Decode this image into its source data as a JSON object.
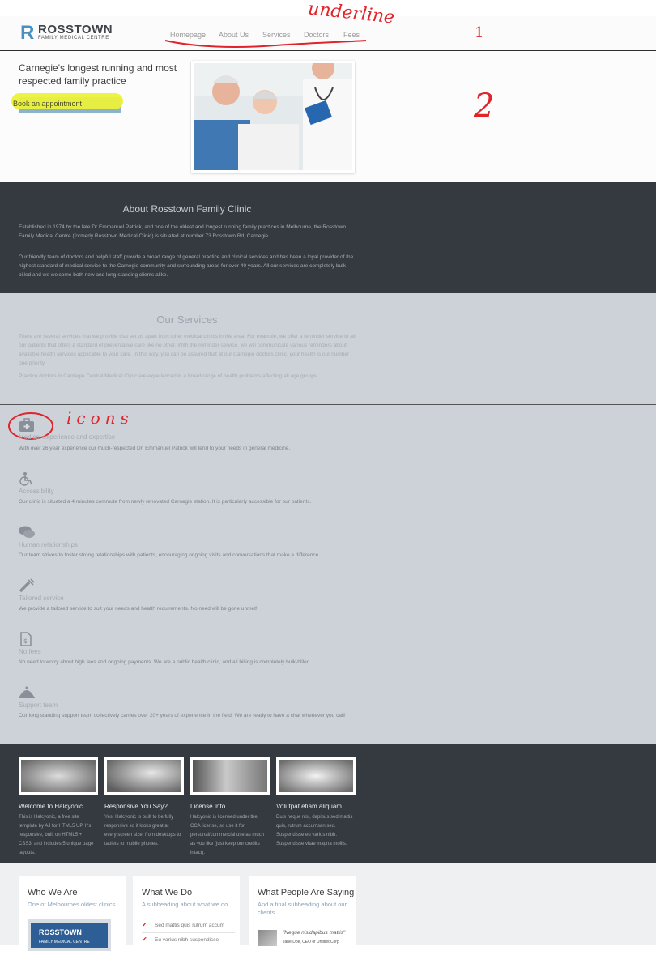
{
  "header": {
    "logo_mark": "R",
    "logo_name": "ROSSTOWN",
    "logo_sub": "FAMILY MEDICAL CENTRE",
    "nav": [
      "Homepage",
      "About Us",
      "Services",
      "Doctors",
      "Fees"
    ]
  },
  "annotations": {
    "underline": "underline",
    "one": "1",
    "two": "2",
    "icons": "icons"
  },
  "hero": {
    "title": "Carnegie's longest running and most respected family practice",
    "button": "Book an appointment"
  },
  "about": {
    "title": "About Rosstown Family Clinic",
    "p1": "Established in 1974 by the late Dr Emmanuel Patrick, and one of the oldest and longest running family practices in Melbourne, the Rosstown Family Medical Centre (formerly Rosstown Medical Clinic) is situated at number 73 Rosstown Rd, Carnegie.",
    "p2": "Our friendly team of doctors and helpful staff provide a broad range of general practice and clinical services and has been a loyal provider of the highest standard of medical service to the Carnegie community and surrounding areas for over 40 years. All our services are completely bulk-billed and we welcome both new and long-standing clients alike."
  },
  "services": {
    "title": "Our Services",
    "p1": "There are several services that we provide that set us apart from other medical clinics in the area. For example, we offer a reminder service to all our patients that offers a standard of preventative care like no other. With the reminder service, we will communicate various reminders about available health services applicable to your care. In this way, you can be assured that at our Carnegie doctors clinic, your health is our number one priority.",
    "p2": "Practice doctors in Carnegie Central Medical Clinic are experienced in a broad range of health problems affecting all age groups.",
    "items": [
      {
        "icon": "medical-kit-icon",
        "title": "Medical experience and expertise",
        "desc": "With over 26 year experience our much-respected Dr. Emmanuel Patrick will tend to your needs in general medicine."
      },
      {
        "icon": "wheelchair-icon",
        "title": "Accessibility",
        "desc": "Our clinic is situated a 4 minutes commute from newly renovated Carnegie station. It is particularly accessible for our patients."
      },
      {
        "icon": "chat-bubbles-icon",
        "title": "Human relationships",
        "desc": "Our team strives to foster strong relationships with patients, encouraging ongoing visits and conversations that make a difference."
      },
      {
        "icon": "syringe-icon",
        "title": "Tailored service",
        "desc": "We provide a tailored service to suit your needs and health requirements. No need will be gone unmet!"
      },
      {
        "icon": "document-icon",
        "title": "No fees",
        "desc": "No need to worry about high fees and ongoing payments. We are a public health clinic, and all billing is completely bulk-billed."
      },
      {
        "icon": "service-bell-icon",
        "title": "Support team",
        "desc": "Our long standing support team collectively carries over 20+ years of experience in the field. We are ready to have a chat whenever you call!"
      }
    ]
  },
  "features": [
    {
      "title": "Welcome to Halcyonic",
      "text": "This is Halcyonic, a free site template by AJ for HTML5 UP. It's responsive, built on HTML5 + CSS3, and includes 5 unique page layouts."
    },
    {
      "title": "Responsive You Say?",
      "text": "Yes! Halcyonic is built to be fully responsive so it looks great at every screen size, from desktops to tablets to mobile phones."
    },
    {
      "title": "License Info",
      "text": "Halcyonic is licensed under the CCA license, so use it for personal/commercial use as much as you like (just keep our credits intact)."
    },
    {
      "title": "Volutpat etiam aliquam",
      "text": "Duis neque nisi, dapibus sed mattis quis, rutrum accumsan sed. Suspendisse eu varius nibh. Suspendisse vitae magna mollis."
    }
  ],
  "cards": [
    {
      "title": "Who We Are",
      "sub": "One of Melbournes oldest clinics"
    },
    {
      "title": "What We Do",
      "sub": "A subheading about what we do",
      "list": [
        "Sed mattis quis rutrum accum",
        "Eu varius nibh suspendisse"
      ]
    },
    {
      "title": "What People Are Saying",
      "sub": "And a final subheading about our clients",
      "quote": "\"Neque nisidapibus mattis\"",
      "quote_author": "Jane Doe, CEO of UntitledCorp"
    }
  ],
  "colors": {
    "accent_yellow": "#ecf13a",
    "annotation_red": "#e0242a",
    "dark_band": "#343a3f",
    "services_bg": "#cdd1d8"
  }
}
